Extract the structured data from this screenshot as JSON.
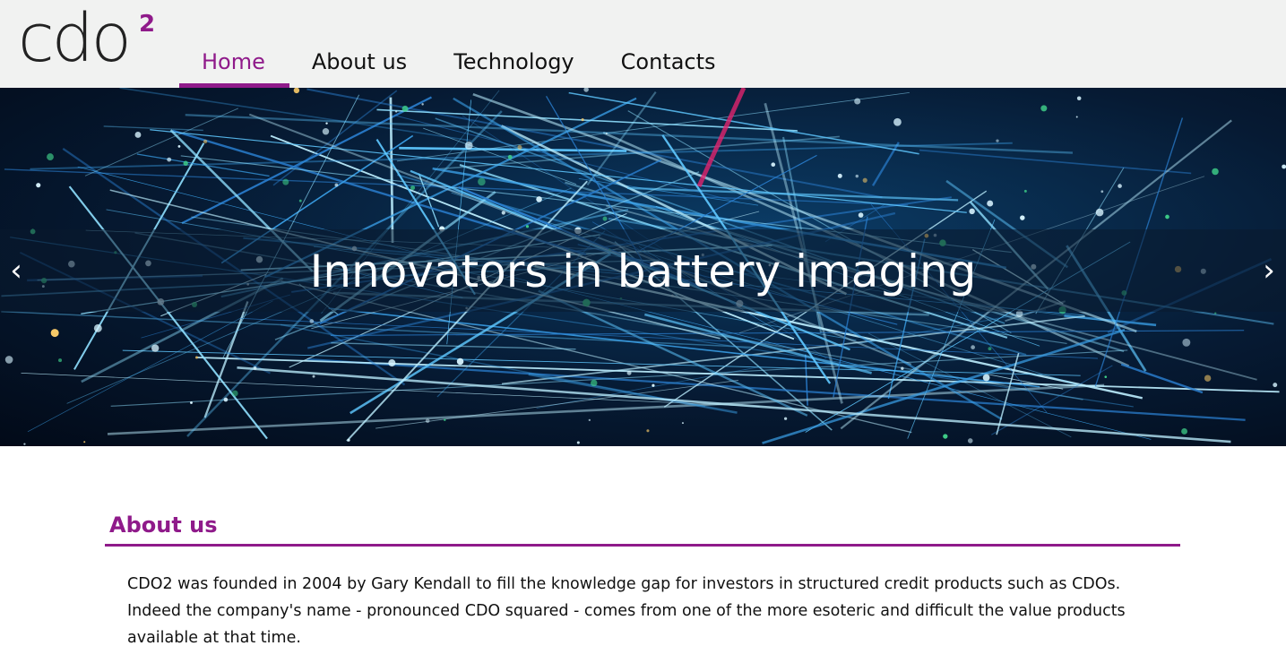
{
  "header": {
    "logo": {
      "text": "cdo",
      "superscript": "2"
    },
    "nav": [
      {
        "label": "Home",
        "active": true
      },
      {
        "label": "About us",
        "active": false
      },
      {
        "label": "Technology",
        "active": false
      },
      {
        "label": "Contacts",
        "active": false
      }
    ]
  },
  "hero": {
    "title": "Innovators in battery imaging",
    "prev_icon": "chevron-left-icon",
    "next_icon": "chevron-right-icon",
    "prev_glyph": "‹",
    "next_glyph": "›"
  },
  "about": {
    "heading": "About us",
    "body": "CDO2 was founded in 2004 by Gary Kendall to fill the knowledge gap for investors in structured credit products such as CDOs. Indeed the company's name - pronounced CDO squared - comes from one of the more esoteric and difficult the value products available at that time."
  },
  "colors": {
    "accent": "#8f1a8a",
    "header_bg": "#f1f2f1"
  }
}
